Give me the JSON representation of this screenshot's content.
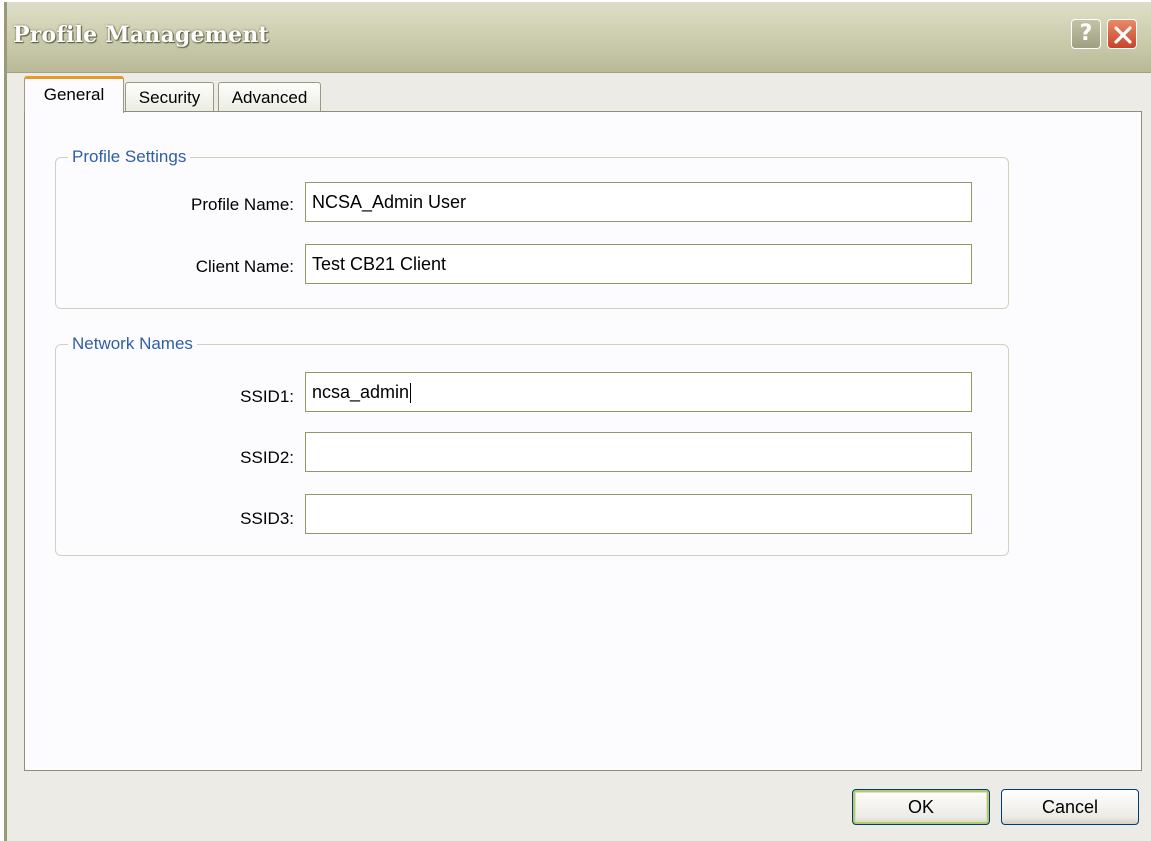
{
  "window": {
    "title": "Profile Management",
    "help_label": "?",
    "close_icon": "close-icon"
  },
  "tabs": [
    {
      "label": "General",
      "active": true
    },
    {
      "label": "Security",
      "active": false
    },
    {
      "label": "Advanced",
      "active": false
    }
  ],
  "profile_settings": {
    "legend": "Profile Settings",
    "profile_name_label": "Profile Name:",
    "profile_name_value": "NCSA_Admin User",
    "client_name_label": "Client Name:",
    "client_name_value": "Test CB21 Client"
  },
  "network_names": {
    "legend": "Network Names",
    "ssid1_label": "SSID1:",
    "ssid1_value": "ncsa_admin",
    "ssid2_label": "SSID2:",
    "ssid2_value": "",
    "ssid3_label": "SSID3:",
    "ssid3_value": ""
  },
  "buttons": {
    "ok_label": "OK",
    "cancel_label": "Cancel"
  },
  "colors": {
    "active_tab_accent": "#e59a2a",
    "group_legend": "#2f5ea8",
    "close_button": "#c8432a"
  }
}
